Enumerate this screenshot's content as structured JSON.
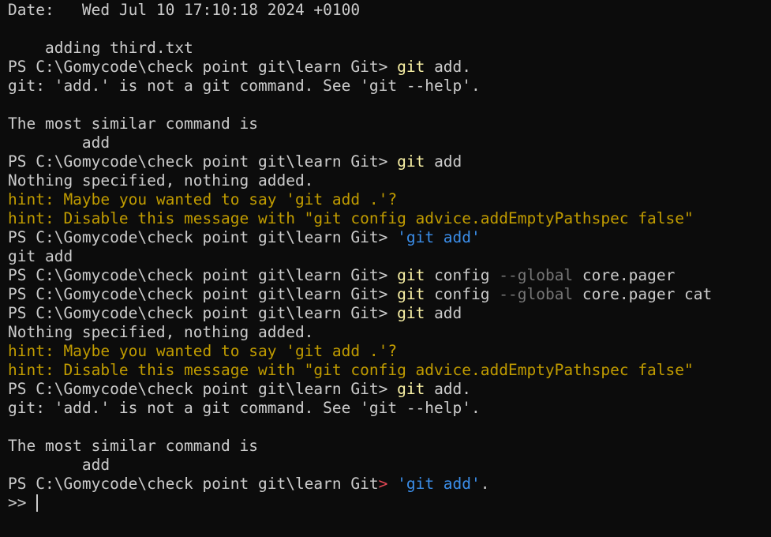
{
  "theme": {
    "background": "#0c0c0c",
    "default": "#cccccc",
    "cmd": "#f9f1a5",
    "str": "#3b8eea",
    "hint": "#c19c00",
    "param": "#767676",
    "err": "#e74856"
  },
  "lines": [
    [
      {
        "t": "Date:   Wed Jul 10 17:10:18 2024 +0100",
        "c": "default"
      }
    ],
    [],
    [
      {
        "t": "    adding third.txt",
        "c": "default"
      }
    ],
    [
      {
        "t": "PS C:\\Gomycode\\check point git\\learn Git> ",
        "c": "default"
      },
      {
        "t": "git",
        "c": "cmd"
      },
      {
        "t": " add.",
        "c": "default"
      }
    ],
    [
      {
        "t": "git: 'add.' is not a git command. See 'git --help'.",
        "c": "default"
      }
    ],
    [],
    [
      {
        "t": "The most similar command is",
        "c": "default"
      }
    ],
    [
      {
        "t": "        add",
        "c": "default"
      }
    ],
    [
      {
        "t": "PS C:\\Gomycode\\check point git\\learn Git> ",
        "c": "default"
      },
      {
        "t": "git",
        "c": "cmd"
      },
      {
        "t": " add",
        "c": "default"
      }
    ],
    [
      {
        "t": "Nothing specified, nothing added.",
        "c": "default"
      }
    ],
    [
      {
        "t": "hint: Maybe you wanted to say 'git add .'?",
        "c": "hint"
      }
    ],
    [
      {
        "t": "hint: Disable this message with \"git config advice.addEmptyPathspec false\"",
        "c": "hint"
      }
    ],
    [
      {
        "t": "PS C:\\Gomycode\\check point git\\learn Git> ",
        "c": "default"
      },
      {
        "t": "'git add'",
        "c": "str"
      }
    ],
    [
      {
        "t": "git add",
        "c": "default"
      }
    ],
    [
      {
        "t": "PS C:\\Gomycode\\check point git\\learn Git> ",
        "c": "default"
      },
      {
        "t": "git",
        "c": "cmd"
      },
      {
        "t": " config ",
        "c": "default"
      },
      {
        "t": "--global",
        "c": "param"
      },
      {
        "t": " core.pager",
        "c": "default"
      }
    ],
    [
      {
        "t": "PS C:\\Gomycode\\check point git\\learn Git> ",
        "c": "default"
      },
      {
        "t": "git",
        "c": "cmd"
      },
      {
        "t": " config ",
        "c": "default"
      },
      {
        "t": "--global",
        "c": "param"
      },
      {
        "t": " core.pager cat",
        "c": "default"
      }
    ],
    [
      {
        "t": "PS C:\\Gomycode\\check point git\\learn Git> ",
        "c": "default"
      },
      {
        "t": "git",
        "c": "cmd"
      },
      {
        "t": " add",
        "c": "default"
      }
    ],
    [
      {
        "t": "Nothing specified, nothing added.",
        "c": "default"
      }
    ],
    [
      {
        "t": "hint: Maybe you wanted to say 'git add .'?",
        "c": "hint"
      }
    ],
    [
      {
        "t": "hint: Disable this message with \"git config advice.addEmptyPathspec false\"",
        "c": "hint"
      }
    ],
    [
      {
        "t": "PS C:\\Gomycode\\check point git\\learn Git> ",
        "c": "default"
      },
      {
        "t": "git",
        "c": "cmd"
      },
      {
        "t": " add.",
        "c": "default"
      }
    ],
    [
      {
        "t": "git: 'add.' is not a git command. See 'git --help'.",
        "c": "default"
      }
    ],
    [],
    [
      {
        "t": "The most similar command is",
        "c": "default"
      }
    ],
    [
      {
        "t": "        add",
        "c": "default"
      }
    ],
    [
      {
        "t": "PS C:\\Gomycode\\check point git\\learn Git",
        "c": "default"
      },
      {
        "t": ">",
        "c": "err"
      },
      {
        "t": " ",
        "c": "default"
      },
      {
        "t": "'git add'",
        "c": "str"
      },
      {
        "t": ".",
        "c": "default"
      }
    ],
    [
      {
        "t": ">> ",
        "c": "default"
      }
    ]
  ]
}
